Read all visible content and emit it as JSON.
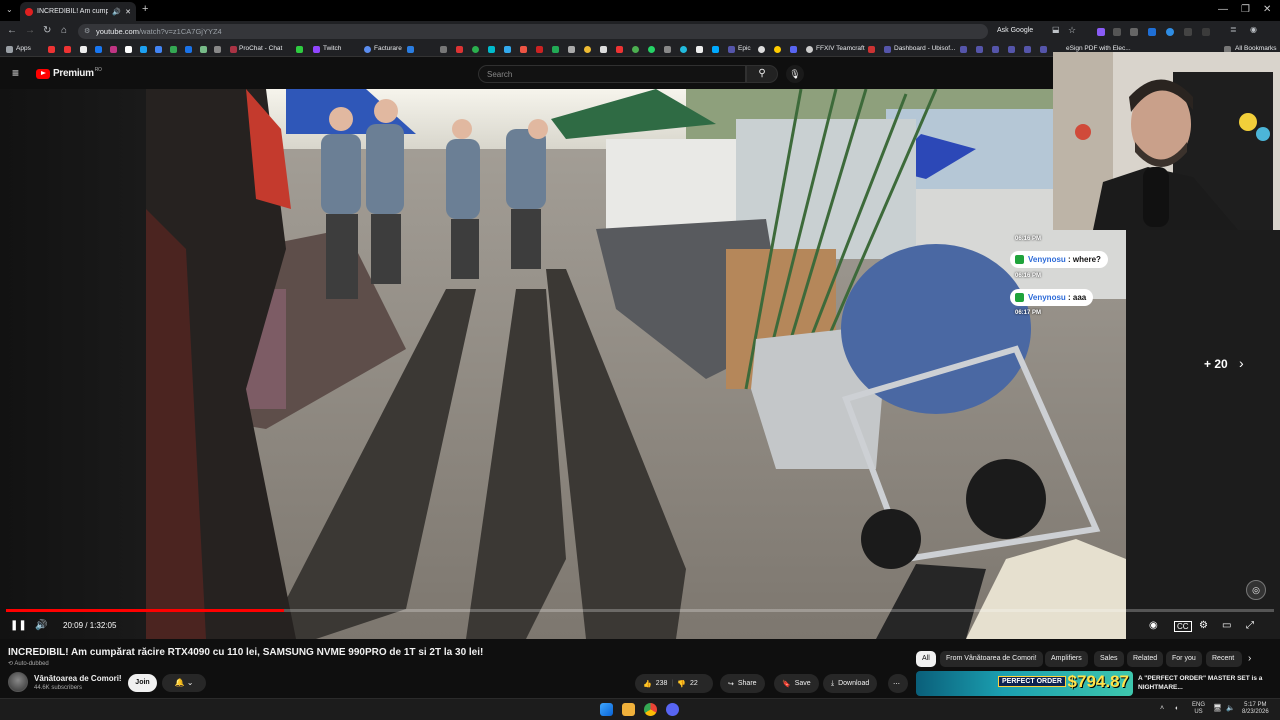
{
  "browser": {
    "tab_title": "INCREDIBIL! Am cumpărat ră...",
    "tab_close": "✕",
    "new_tab": "+",
    "url_host": "youtube.com",
    "url_path": "/watch?v=z1CA7GjYYZ4",
    "ask_google": "Ask Google",
    "window_min": "—",
    "window_max": "❐",
    "window_close": "✕"
  },
  "bookmarks": {
    "apps": "Apps",
    "items": [
      "ProChat - Chat",
      "Twitch",
      "Facturare",
      "Epic",
      "FFXIV Teamcraft",
      "Dashboard - Ubisof...",
      "eSign PDF with Elec..."
    ],
    "all": "All Bookmarks"
  },
  "youtube": {
    "logo_text": "Premium",
    "logo_sup": "RO",
    "search_placeholder": "Search"
  },
  "player": {
    "current_time": "20:09",
    "duration": "1:32:05",
    "time_sep": " / ",
    "progress_fraction": 0.219,
    "next_count": "+ 20"
  },
  "chat": [
    {
      "time": "06:16 PM",
      "user": "Venynosu",
      "text": "where?"
    },
    {
      "time": "06:16 PM",
      "user": "Venynosu",
      "text": "aaa"
    },
    {
      "time": "06:17 PM"
    }
  ],
  "video": {
    "title": "INCREDIBIL! Am cumpărat răcire RTX4090 cu 110 lei, SAMSUNG NVME 990PRO de 1T si 2T la 30 lei!",
    "auto_dubbed": "Auto-dubbed",
    "channel": "Vânătoarea de Comori!",
    "subscribers": "44.6K subscribers",
    "join": "Join",
    "likes": "238",
    "dislikes": "22",
    "share": "Share",
    "save": "Save",
    "download": "Download",
    "more": "⋯"
  },
  "chips": [
    "All",
    "From Vânătoarea de Comori!",
    "Amplifiers",
    "Sales",
    "Related",
    "For you",
    "Recent"
  ],
  "recommendation": {
    "title": "A \"PERFECT ORDER\" MASTER SET is a NIGHTMARE...",
    "thumb_price": "$794.87",
    "thumb_text": "PERFECT ORDER"
  },
  "taskbar": {
    "lang_top": "ENG",
    "lang_bottom": "US",
    "time": "5:17 PM",
    "date": "8/23/2026"
  },
  "colors": {
    "accent_red": "#ff0000",
    "chat_badge": "#1fa33b",
    "background": "#0f0f0f"
  }
}
